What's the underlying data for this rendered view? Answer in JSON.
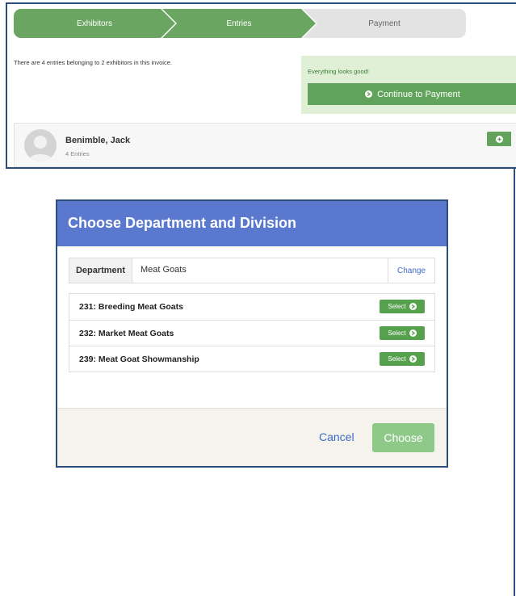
{
  "steps": [
    "Exhibitors",
    "Entries",
    "Payment"
  ],
  "invoice": {
    "summary": "There are 4 entries belonging to 2 exhibitors in this invoice.",
    "status_text": "Everything looks good!",
    "continue_label": "Continue to Payment"
  },
  "exhibitor": {
    "name": "Benimble, Jack",
    "entries": "4 Entries"
  },
  "modal": {
    "title": "Choose Department and Division",
    "department_label": "Department",
    "department_value": "Meat Goats",
    "change_label": "Change",
    "select_label": "Select",
    "divisions": [
      "231: Breeding Meat Goats",
      "232: Market Meat Goats",
      "239: Meat Goat Showmanship"
    ],
    "cancel_label": "Cancel",
    "choose_label": "Choose"
  },
  "colors": {
    "accent_green": "#62a35c",
    "header_blue": "#5a78cd",
    "link_blue": "#3b6bc7",
    "frame_border": "#2b4d7f"
  },
  "icons": [
    "circle-arrow-right-icon",
    "user-avatar-icon",
    "plus-circle-icon"
  ]
}
